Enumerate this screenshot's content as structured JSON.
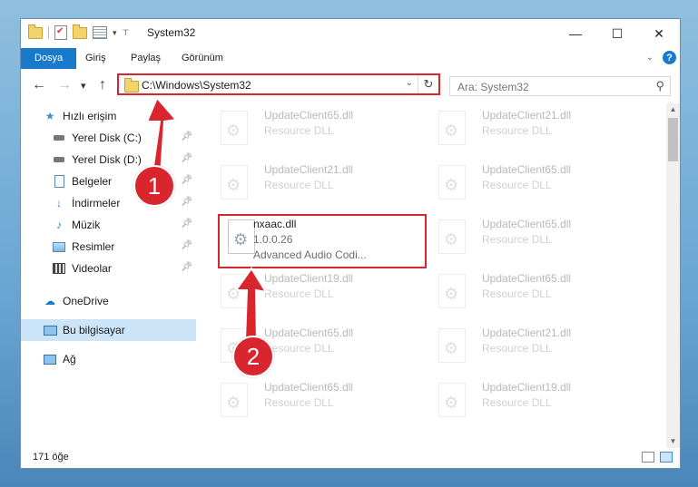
{
  "window": {
    "title": "System32",
    "controls": {
      "minimize": "—",
      "maximize": "☐",
      "close": "✕"
    }
  },
  "ribbon": {
    "tabs": [
      "Dosya",
      "Giriş",
      "Paylaş",
      "Görünüm"
    ],
    "expand_icon": "chevron-down-icon",
    "help_label": "?"
  },
  "navigation": {
    "back": "←",
    "forward": "→",
    "recent": "▾",
    "up": "↑",
    "address": "C:\\Windows\\System32",
    "refresh": "↻",
    "search_placeholder": "Ara: System32"
  },
  "sidebar": {
    "items": [
      {
        "label": "Hızlı erişim",
        "icon": "star-icon",
        "pinned": false
      },
      {
        "label": "Yerel Disk (C:)",
        "icon": "drive-icon",
        "pinned": true
      },
      {
        "label": "Yerel Disk (D:)",
        "icon": "drive-icon",
        "pinned": true
      },
      {
        "label": "Belgeler",
        "icon": "document-icon",
        "pinned": true
      },
      {
        "label": "İndirmeler",
        "icon": "download-icon",
        "pinned": true
      },
      {
        "label": "Müzik",
        "icon": "music-icon",
        "pinned": true
      },
      {
        "label": "Resimler",
        "icon": "picture-icon",
        "pinned": true
      },
      {
        "label": "Videolar",
        "icon": "video-icon",
        "pinned": true
      },
      {
        "label": "OneDrive",
        "icon": "cloud-icon",
        "pinned": false
      },
      {
        "label": "Bu bilgisayar",
        "icon": "computer-icon",
        "pinned": false,
        "selected": true
      },
      {
        "label": "Ağ",
        "icon": "network-icon",
        "pinned": false
      }
    ]
  },
  "files": [
    {
      "name": "UpdateClient65.dll",
      "desc": "Resource DLL"
    },
    {
      "name": "UpdateClient21.dll",
      "desc": "Resource DLL"
    },
    {
      "name": "UpdateClient21.dll",
      "desc": "Resource DLL"
    },
    {
      "name": "UpdateClient65.dll",
      "desc": "Resource DLL"
    },
    {
      "name": "nxaac.dll",
      "version": "1.0.0.26",
      "desc": "Advanced Audio Codi..."
    },
    {
      "name": "UpdateClient65.dll",
      "desc": "Resource DLL"
    },
    {
      "name": "UpdateClient19.dll",
      "desc": "Resource DLL"
    },
    {
      "name": "UpdateClient65.dll",
      "desc": "Resource DLL"
    },
    {
      "name": "UpdateClient65.dll",
      "desc": "Resource DLL"
    },
    {
      "name": "UpdateClient21.dll",
      "desc": "Resource DLL"
    },
    {
      "name": "UpdateClient65.dll",
      "desc": "Resource DLL"
    },
    {
      "name": "UpdateClient19.dll",
      "desc": "Resource DLL"
    }
  ],
  "status": {
    "count": "171 öğe"
  },
  "annotations": {
    "step1": "1",
    "step2": "2",
    "color": "#d9262e"
  }
}
